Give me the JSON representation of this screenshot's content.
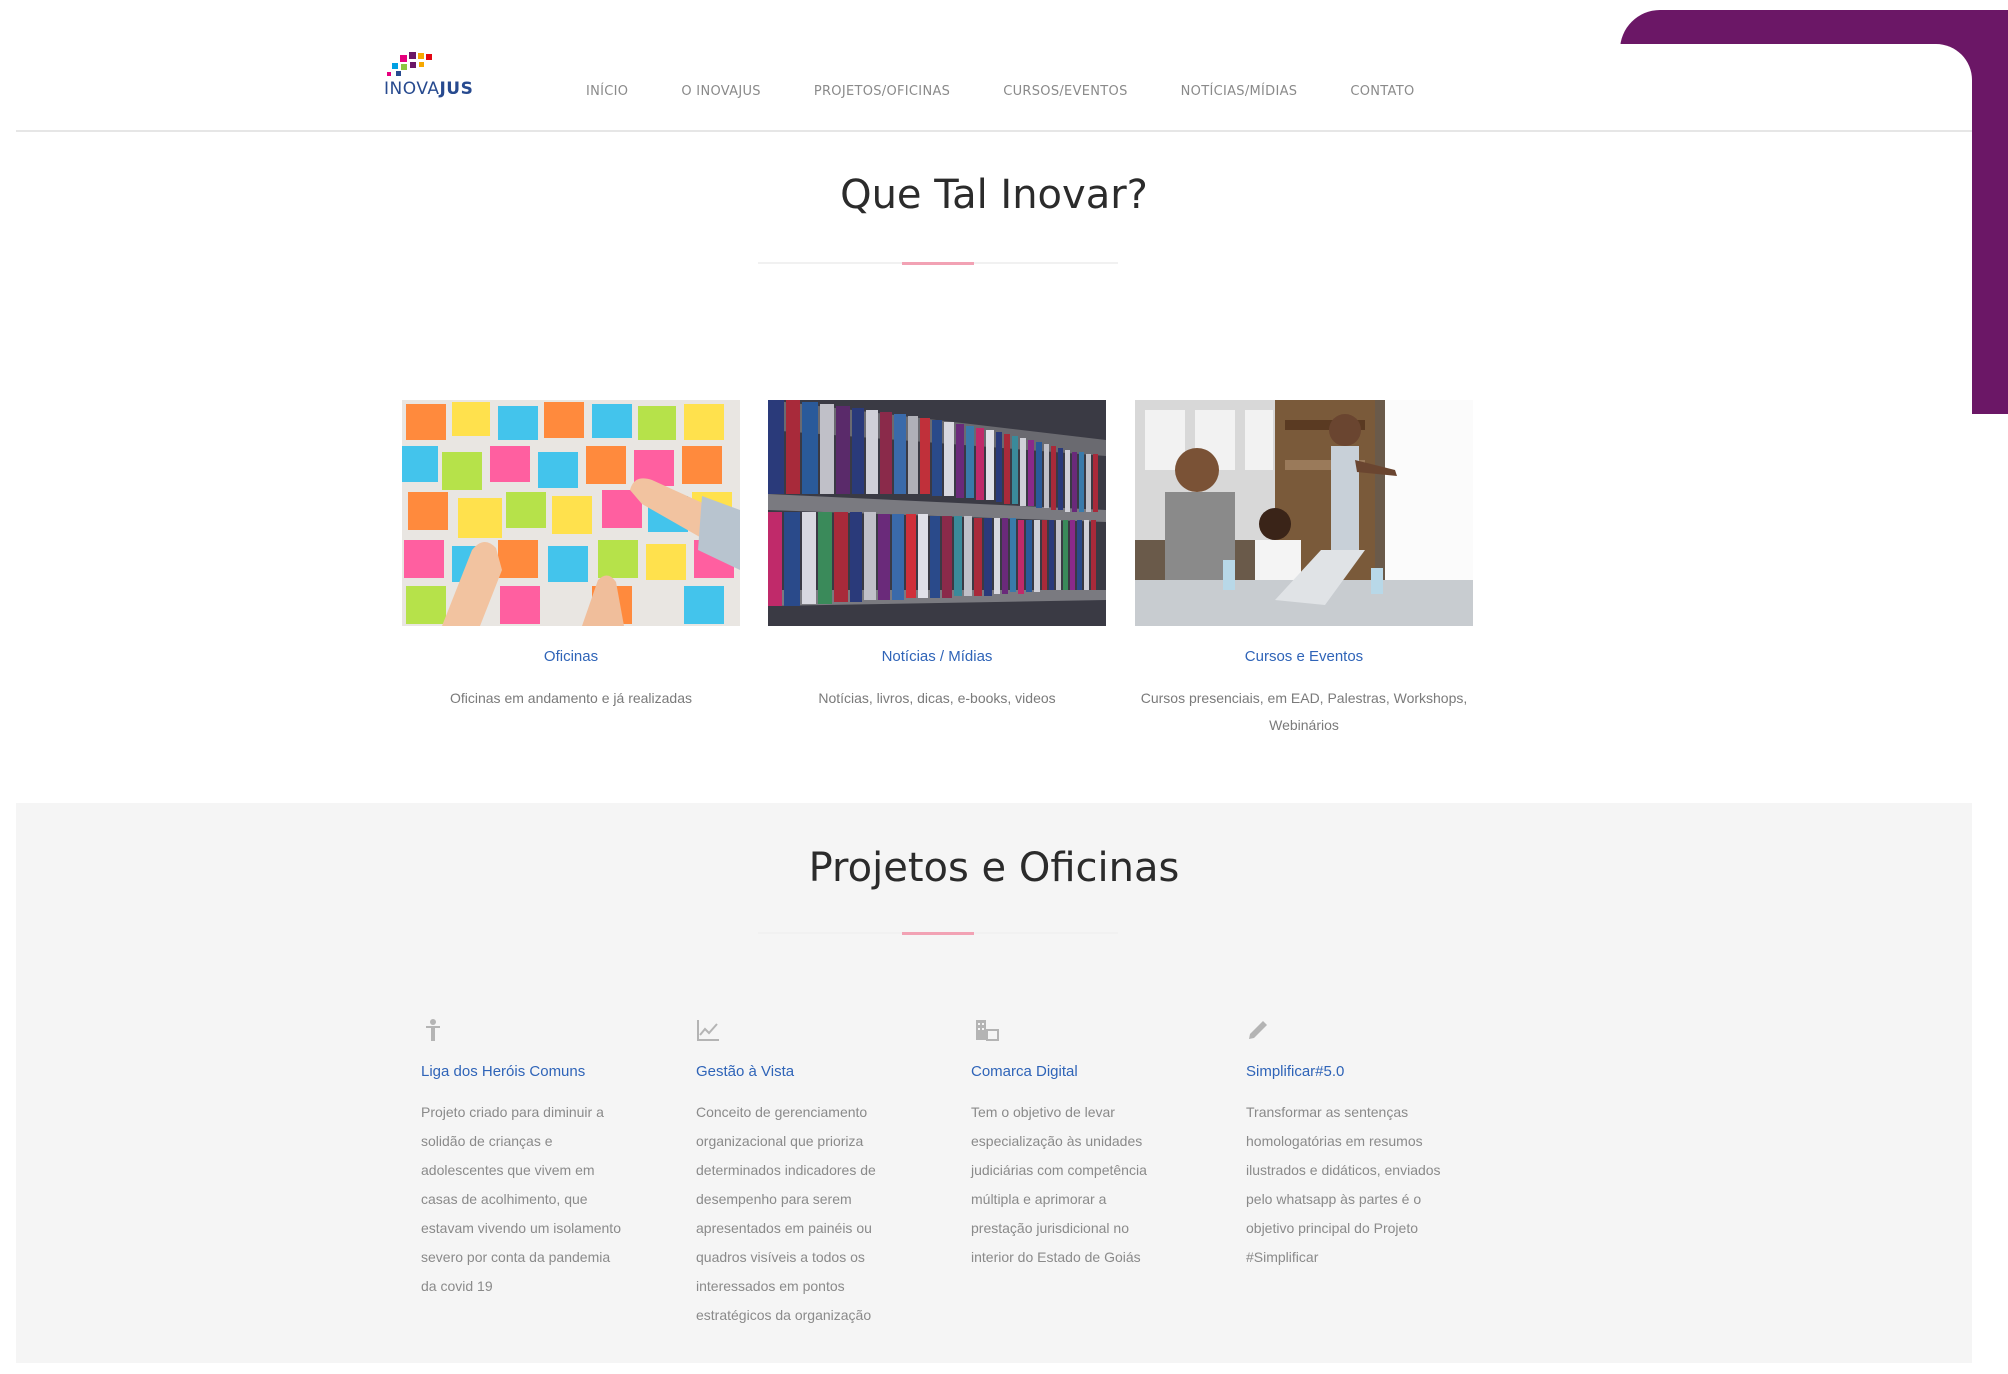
{
  "header": {
    "logo": {
      "text_left": "INOVA",
      "text_right": "JUS"
    },
    "nav": [
      "INÍCIO",
      "O INOVAJUS",
      "PROJETOS/OFICINAS",
      "CURSOS/EVENTOS",
      "NOTÍCIAS/MÍDIAS",
      "CONTATO"
    ]
  },
  "section_inovar": {
    "title": "Que Tal Inovar?",
    "cards": [
      {
        "title": "Oficinas",
        "desc": "Oficinas em andamento e já realizadas"
      },
      {
        "title": "Notícias / Mídias",
        "desc": "Notícias, livros, dicas, e-books, videos"
      },
      {
        "title": "Cursos e Eventos",
        "desc": "Cursos presenciais, em EAD, Palestras, Workshops, Webinários"
      }
    ]
  },
  "section_projetos": {
    "title": "Projetos e Oficinas",
    "projects": [
      {
        "icon": "person-icon",
        "title": "Liga dos Heróis Comuns",
        "desc": "Projeto criado para diminuir a solidão de crianças e adolescentes que vivem em casas de acolhimento, que estavam vivendo um isolamento severo por conta da pandemia da covid 19"
      },
      {
        "icon": "chart-icon",
        "title": "Gestão à Vista",
        "desc": "Conceito de gerenciamento organizacional que prioriza determinados indicadores de desempenho para serem apresentados em painéis ou quadros visíveis a todos os interessados em pontos estratégicos da organização"
      },
      {
        "icon": "building-icon",
        "title": "Comarca Digital",
        "desc": "Tem o objetivo de levar especialização às unidades judiciárias com competência múltipla e aprimorar a prestação jurisdicional no interior do Estado de Goiás"
      },
      {
        "icon": "pencil-icon",
        "title": "Simplificar#5.0",
        "desc": "Transformar as sentenças homologatórias em resumos ilustrados e didáticos, enviados pelo whatsapp às partes é o objetivo principal do Projeto #Simplificar"
      }
    ]
  },
  "colors": {
    "frame": "#6b1766",
    "link": "#2f64b8",
    "accent": "#f2a2b4"
  }
}
